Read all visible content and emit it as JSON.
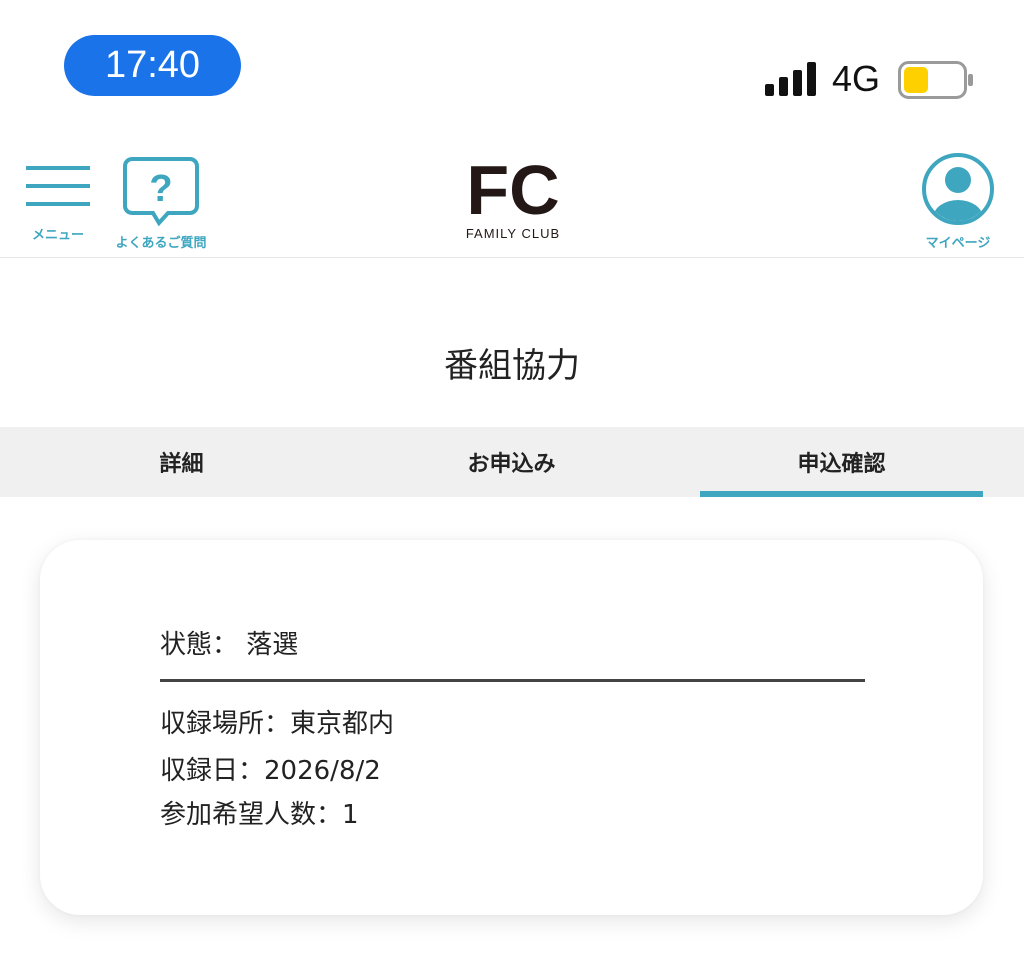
{
  "status_bar": {
    "time": "17:40",
    "network": "4G",
    "colors": {
      "time_pill": "#1a73e8",
      "battery_level": "#ffd000"
    }
  },
  "header": {
    "menu_label": "メニュー",
    "faq_label": "よくあるご質問",
    "logo_mark": "FC",
    "logo_text": "FAMILY CLUB",
    "mypage_label": "マイページ",
    "accent": "#3fa6c0"
  },
  "page": {
    "title": "番組協力"
  },
  "tabs": [
    {
      "label": "詳細",
      "active": false
    },
    {
      "label": "お申込み",
      "active": false
    },
    {
      "label": "申込確認",
      "active": true
    }
  ],
  "application": {
    "status_label": "状態：",
    "status_value": "落選",
    "details": [
      {
        "label": "収録場所：",
        "value": "東京都内"
      },
      {
        "label": "収録日：",
        "value": "2026/8/2"
      },
      {
        "label": "参加希望人数：",
        "value": "1"
      }
    ]
  }
}
